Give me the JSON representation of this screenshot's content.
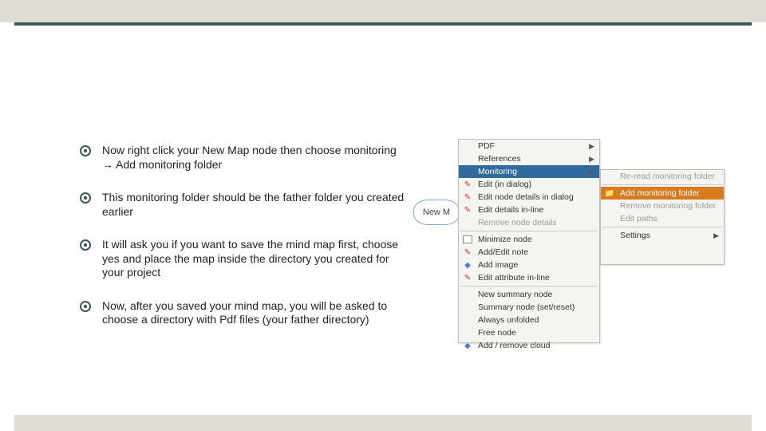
{
  "bullets": [
    "Now right click your New Map node then choose monitoring → Add monitoring folder",
    "This monitoring folder should be the father folder you created earlier",
    "It will ask you if you want to save the mind map first, choose yes and place the map inside the directory you created for your project",
    "Now, after you saved your mind map, you will be asked to choose a directory with Pdf files (your father directory)"
  ],
  "node_label": "New M",
  "primary_menu": {
    "items": [
      {
        "label": "PDF",
        "arrow": true
      },
      {
        "label": "References",
        "arrow": true
      },
      {
        "label": "Monitoring",
        "arrow": true,
        "selected": true
      },
      {
        "label": "Edit (in dialog)",
        "icon": "red"
      },
      {
        "label": "Edit node details in dialog",
        "icon": "red"
      },
      {
        "label": "Edit details in-line",
        "icon": "red"
      },
      {
        "label": "Remove node details",
        "disabled": true
      },
      {
        "sep": true
      },
      {
        "label": "Minimize node",
        "icon": "box"
      },
      {
        "label": "Add/Edit note",
        "icon": "red"
      },
      {
        "label": "Add image",
        "icon": "blue"
      },
      {
        "label": "Edit attribute in-line",
        "icon": "red"
      },
      {
        "sep": true
      },
      {
        "label": "New summary node"
      },
      {
        "label": "Summary node (set/reset)"
      },
      {
        "label": "Always unfolded"
      },
      {
        "label": "Free node"
      },
      {
        "label": "Add / remove cloud",
        "icon": "blue"
      }
    ]
  },
  "secondary_menu": {
    "items": [
      {
        "label": "Re-read monitoring folder",
        "disabled": true
      },
      {
        "sep": true
      },
      {
        "label": "Add monitoring folder",
        "selected_orange": true,
        "icon": "folder"
      },
      {
        "label": "Remove monitoring folder",
        "disabled": true
      },
      {
        "label": "Edit paths",
        "disabled": true
      },
      {
        "sep": true
      },
      {
        "label": "Settings",
        "arrow": true
      }
    ]
  }
}
